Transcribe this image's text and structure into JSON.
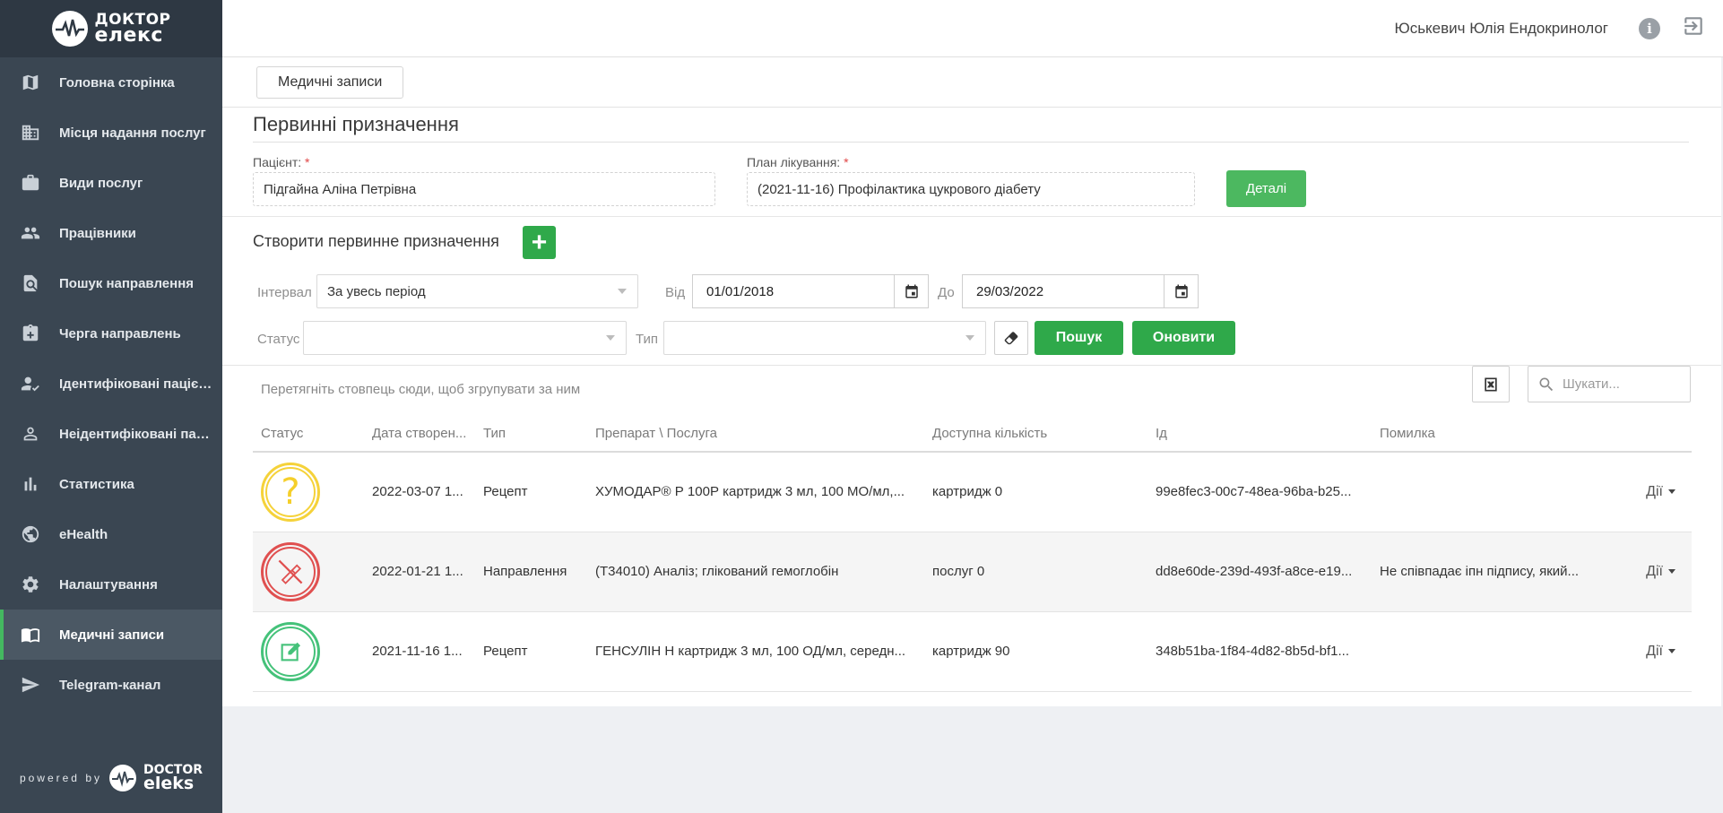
{
  "sidebar": {
    "logo_line1": "ДОКТОР",
    "logo_line2": "елекс",
    "items": [
      {
        "label": "Головна сторінка",
        "icon": "map-icon"
      },
      {
        "label": "Місця надання послуг",
        "icon": "building-icon"
      },
      {
        "label": "Види послуг",
        "icon": "briefcase-icon"
      },
      {
        "label": "Працівники",
        "icon": "people-icon"
      },
      {
        "label": "Пошук направлення",
        "icon": "doc-search-icon"
      },
      {
        "label": "Черга направлень",
        "icon": "clipboard-icon"
      },
      {
        "label": "Ідентифіковані пацієнти",
        "icon": "person-check-icon"
      },
      {
        "label": "Неідентифіковані паціє...",
        "icon": "person-outline-icon"
      },
      {
        "label": "Статистика",
        "icon": "bar-chart-icon"
      },
      {
        "label": "eHealth",
        "icon": "globe-icon"
      },
      {
        "label": "Налаштування",
        "icon": "gear-icon"
      },
      {
        "label": "Медичні записи",
        "icon": "book-icon",
        "active": true
      },
      {
        "label": "Telegram-канал",
        "icon": "send-icon"
      }
    ],
    "powered_by": "powered by",
    "powered_line1": "DOCTOR",
    "powered_line2": "eleks"
  },
  "header": {
    "user": "Юськевич Юлія Ендокринолог"
  },
  "tabs": {
    "active": "Медичні записи"
  },
  "page": {
    "title": "Первинні призначення",
    "patient_label": "Пацієнт:",
    "patient_value": "Підгайна Аліна Петрівна",
    "plan_label": "План лікування:",
    "plan_value": "(2021-11-16) Профілактика цукрового діабету",
    "required_mark": "*",
    "details_button": "Деталі",
    "create_title": "Створити первинне призначення",
    "plus": "+"
  },
  "filters": {
    "interval_label": "Інтервал",
    "interval_value": "За увесь період",
    "from_label": "Від",
    "from_value": "01/01/2018",
    "to_label": "До",
    "to_value": "29/03/2022",
    "status_label": "Статус",
    "status_value": "",
    "type_label": "Тип",
    "type_value": "",
    "search_button": "Пошук",
    "refresh_button": "Оновити"
  },
  "grid": {
    "group_hint": "Перетягніть стовпець сюди, щоб згрупувати за ним",
    "search_placeholder": "Шукати...",
    "columns": [
      "Статус",
      "Дата створен...",
      "Тип",
      "Препарат \\ Послуга",
      "Доступна кількість",
      "Ід",
      "Помилка"
    ],
    "rows": [
      {
        "status": "question",
        "date": "2022-03-07 1...",
        "type": "Рецепт",
        "item": "ХУМОДАР® Р 100Р картридж 3 мл, 100 МО/мл,...",
        "qty": "картридж 0",
        "id": "99e8fec3-00c7-48ea-96ba-b25...",
        "error": "",
        "actions": "Дії"
      },
      {
        "status": "failed",
        "date": "2022-01-21 1...",
        "type": "Направлення",
        "item": "(Т34010) Аналіз; глікований гемоглобін",
        "qty": "послуг 0",
        "id": "dd8e60de-239d-493f-a8ce-e19...",
        "error": "Не співпадає іпн підпису, який...",
        "actions": "Дії"
      },
      {
        "status": "signed",
        "date": "2021-11-16 1...",
        "type": "Рецепт",
        "item": "ГЕНСУЛІН Н картридж 3 мл, 100 ОД/мл, середн...",
        "qty": "картридж 90",
        "id": "348b51ba-1f84-4d82-8b5d-bf1...",
        "error": "",
        "actions": "Дії"
      }
    ]
  }
}
